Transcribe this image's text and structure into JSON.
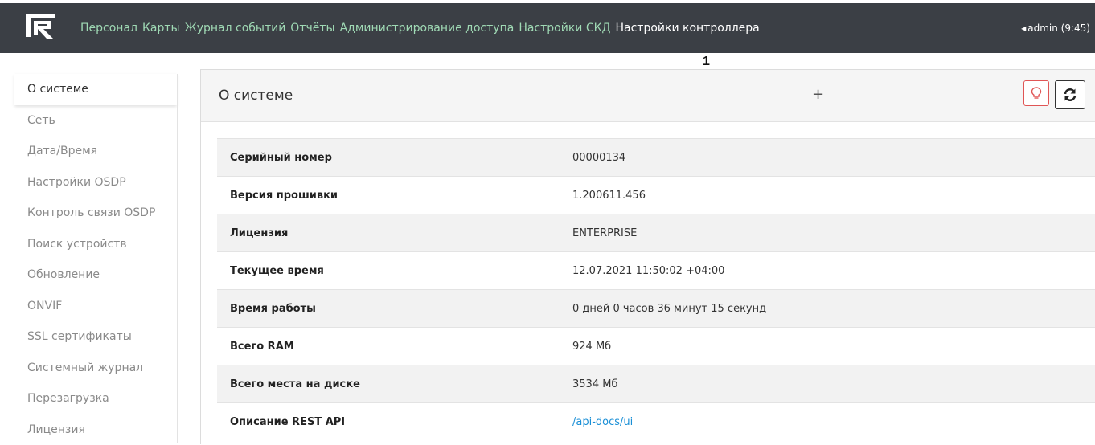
{
  "nav": {
    "items": [
      {
        "label": "Персонал",
        "active": false
      },
      {
        "label": "Карты",
        "active": false
      },
      {
        "label": "Журнал событий",
        "active": false
      },
      {
        "label": "Отчёты",
        "active": false
      },
      {
        "label": "Администрирование доступа",
        "active": false
      },
      {
        "label": "Настройки СКД",
        "active": false
      },
      {
        "label": "Настройки контроллера",
        "active": true
      }
    ],
    "user": "admin (9:45)"
  },
  "annotation": "1",
  "sidebar": {
    "items": [
      {
        "label": "О системе",
        "active": true
      },
      {
        "label": "Сеть"
      },
      {
        "label": "Дата/Время"
      },
      {
        "label": "Настройки OSDP"
      },
      {
        "label": "Контроль связи OSDP"
      },
      {
        "label": "Поиск устройств"
      },
      {
        "label": "Обновление"
      },
      {
        "label": "ONVIF"
      },
      {
        "label": "SSL сертификаты"
      },
      {
        "label": "Системный журнал"
      },
      {
        "label": "Перезагрузка"
      },
      {
        "label": "Лицензия"
      }
    ]
  },
  "panel": {
    "title": "О системе",
    "plus": "+"
  },
  "info": {
    "rows": [
      {
        "key": "Серийный номер",
        "value": "00000134"
      },
      {
        "key": "Версия прошивки",
        "value": "1.200611.456"
      },
      {
        "key": "Лицензия",
        "value": "ENTERPRISE"
      },
      {
        "key": "Текущее время",
        "value": "12.07.2021 11:50:02 +04:00"
      },
      {
        "key": "Время работы",
        "value": "0 дней 0 часов 36 минут 15 секунд"
      },
      {
        "key": "Всего RAM",
        "value": "924 Мб"
      },
      {
        "key": "Всего места на диске",
        "value": "3534 Мб"
      },
      {
        "key": "Описание REST API",
        "value": "/api-docs/ui",
        "link": true
      }
    ]
  },
  "colors": {
    "navbar": "#3b3f45",
    "nav_link": "#9fd9b4",
    "link": "#1a8fd6",
    "danger": "#e05555"
  },
  "icons": {
    "logo": "brand-logo-icon",
    "bulb": "lightbulb-icon",
    "refresh": "refresh-icon",
    "plus": "plus-icon",
    "caret": "caret-left-icon"
  }
}
